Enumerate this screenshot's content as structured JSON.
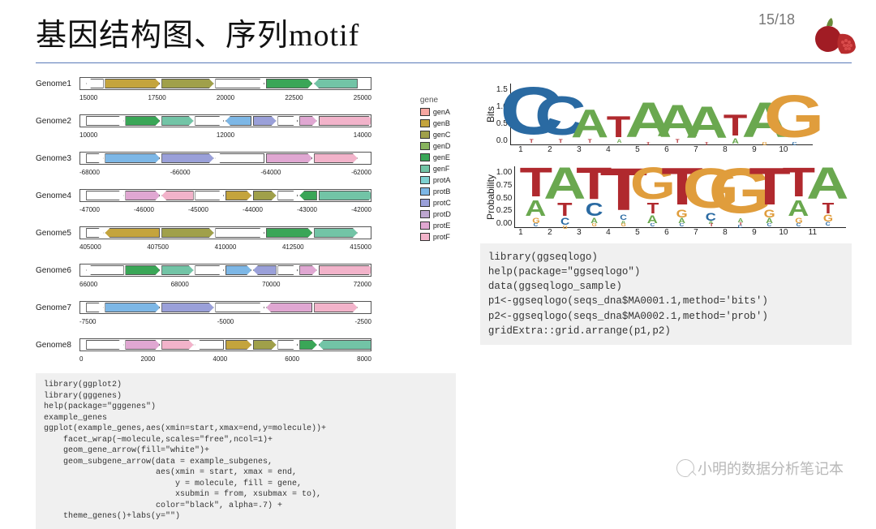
{
  "header": {
    "title": "基因结构图、序列motif",
    "page": "15/18"
  },
  "legend": {
    "title": "gene",
    "items": [
      {
        "label": "genA",
        "color": "#f5a6a0"
      },
      {
        "label": "genB",
        "color": "#c4a43d"
      },
      {
        "label": "genC",
        "color": "#a0a04a"
      },
      {
        "label": "genD",
        "color": "#87b35d"
      },
      {
        "label": "genE",
        "color": "#3aa657"
      },
      {
        "label": "genF",
        "color": "#72c4a6"
      },
      {
        "label": "protA",
        "color": "#7ed1d1"
      },
      {
        "label": "protB",
        "color": "#7db7e6"
      },
      {
        "label": "protC",
        "color": "#9aa0d9"
      },
      {
        "label": "protD",
        "color": "#bda6cf"
      },
      {
        "label": "protE",
        "color": "#e0a7d2"
      },
      {
        "label": "protF",
        "color": "#f2b3ca"
      }
    ]
  },
  "tracks": [
    {
      "name": "Genome1",
      "ticks": [
        "15000",
        "17500",
        "20000",
        "22500",
        "25000"
      ]
    },
    {
      "name": "Genome2",
      "ticks": [
        "10000",
        "12000",
        "14000"
      ]
    },
    {
      "name": "Genome3",
      "ticks": [
        "-68000",
        "-66000",
        "-64000",
        "-62000"
      ]
    },
    {
      "name": "Genome4",
      "ticks": [
        "-47000",
        "-46000",
        "-45000",
        "-44000",
        "-43000",
        "-42000"
      ]
    },
    {
      "name": "Genome5",
      "ticks": [
        "405000",
        "407500",
        "410000",
        "412500",
        "415000"
      ]
    },
    {
      "name": "Genome6",
      "ticks": [
        "66000",
        "68000",
        "70000",
        "72000"
      ]
    },
    {
      "name": "Genome7",
      "ticks": [
        "-7500",
        "-5000",
        "-2500"
      ]
    },
    {
      "name": "Genome8",
      "ticks": [
        "0",
        "2000",
        "4000",
        "6000",
        "8000"
      ]
    }
  ],
  "chart_data": [
    {
      "type": "sequence_logo",
      "method": "bits",
      "ylabel": "Bits",
      "yticks": [
        "0.0",
        "0.5",
        "1.0",
        "1.5"
      ],
      "positions": [
        1,
        2,
        3,
        4,
        5,
        6,
        7,
        8,
        9,
        10
      ],
      "columns": [
        [
          {
            "l": "C",
            "h": 1.35
          },
          {
            "l": "T",
            "h": 0.1
          }
        ],
        [
          {
            "l": "C",
            "h": 1.1
          },
          {
            "l": "T",
            "h": 0.1
          }
        ],
        [
          {
            "l": "A",
            "h": 0.8
          },
          {
            "l": "T",
            "h": 0.1
          }
        ],
        [
          {
            "l": "T",
            "h": 0.6
          },
          {
            "l": "A",
            "h": 0.1
          }
        ],
        [
          {
            "l": "A",
            "h": 1.0
          },
          {
            "l": "T",
            "h": 0.05
          }
        ],
        [
          {
            "l": "A",
            "h": 0.9
          },
          {
            "l": "T",
            "h": 0.1
          }
        ],
        [
          {
            "l": "A",
            "h": 0.9
          },
          {
            "l": "T",
            "h": 0.05
          }
        ],
        [
          {
            "l": "T",
            "h": 0.6
          },
          {
            "l": "A",
            "h": 0.15
          }
        ],
        [
          {
            "l": "A",
            "h": 1.0
          },
          {
            "l": "G",
            "h": 0.05
          }
        ],
        [
          {
            "l": "G",
            "h": 1.2
          },
          {
            "l": "C",
            "h": 0.05
          }
        ]
      ],
      "ymax": 1.5
    },
    {
      "type": "sequence_logo",
      "method": "probability",
      "ylabel": "Probability",
      "yticks": [
        "0.00",
        "0.25",
        "0.50",
        "0.75",
        "1.00"
      ],
      "positions": [
        1,
        2,
        3,
        4,
        5,
        6,
        7,
        8,
        9,
        10,
        11
      ],
      "columns": [
        [
          {
            "l": "T",
            "h": 0.55
          },
          {
            "l": "A",
            "h": 0.3
          },
          {
            "l": "G",
            "h": 0.1
          },
          {
            "l": "C",
            "h": 0.05
          }
        ],
        [
          {
            "l": "A",
            "h": 0.6
          },
          {
            "l": "T",
            "h": 0.25
          },
          {
            "l": "C",
            "h": 0.13
          },
          {
            "l": "G",
            "h": 0.02
          }
        ],
        [
          {
            "l": "T",
            "h": 0.6
          },
          {
            "l": "C",
            "h": 0.25
          },
          {
            "l": "A",
            "h": 0.1
          },
          {
            "l": "G",
            "h": 0.05
          }
        ],
        [
          {
            "l": "T",
            "h": 0.8
          },
          {
            "l": "C",
            "h": 0.1
          },
          {
            "l": "A",
            "h": 0.05
          },
          {
            "l": "G",
            "h": 0.05
          }
        ],
        [
          {
            "l": "G",
            "h": 0.6
          },
          {
            "l": "T",
            "h": 0.2
          },
          {
            "l": "A",
            "h": 0.15
          },
          {
            "l": "C",
            "h": 0.05
          }
        ],
        [
          {
            "l": "T",
            "h": 0.7
          },
          {
            "l": "G",
            "h": 0.15
          },
          {
            "l": "A",
            "h": 0.1
          },
          {
            "l": "C",
            "h": 0.05
          }
        ],
        [
          {
            "l": "G",
            "h": 0.75
          },
          {
            "l": "C",
            "h": 0.15
          },
          {
            "l": "A",
            "h": 0.05
          },
          {
            "l": "T",
            "h": 0.05
          }
        ],
        [
          {
            "l": "G",
            "h": 0.85
          },
          {
            "l": "A",
            "h": 0.08
          },
          {
            "l": "T",
            "h": 0.04
          },
          {
            "l": "C",
            "h": 0.03
          }
        ],
        [
          {
            "l": "T",
            "h": 0.7
          },
          {
            "l": "G",
            "h": 0.15
          },
          {
            "l": "A",
            "h": 0.1
          },
          {
            "l": "C",
            "h": 0.05
          }
        ],
        [
          {
            "l": "T",
            "h": 0.55
          },
          {
            "l": "A",
            "h": 0.3
          },
          {
            "l": "G",
            "h": 0.1
          },
          {
            "l": "C",
            "h": 0.05
          }
        ],
        [
          {
            "l": "A",
            "h": 0.6
          },
          {
            "l": "T",
            "h": 0.2
          },
          {
            "l": "G",
            "h": 0.13
          },
          {
            "l": "C",
            "h": 0.07
          }
        ]
      ],
      "ymax": 1.0
    }
  ],
  "code_left": "library(ggplot2)\nlibrary(gggenes)\nhelp(package=\"gggenes\")\nexample_genes\nggplot(example_genes,aes(xmin=start,xmax=end,y=molecule))+\n    facet_wrap(~molecule,scales=\"free\",ncol=1)+\n    geom_gene_arrow(fill=\"white\")+\n    geom_subgene_arrow(data = example_subgenes,\n                       aes(xmin = start, xmax = end,\n                           y = molecule, fill = gene,\n                           xsubmin = from, xsubmax = to),\n                       color=\"black\", alpha=.7) +\n    theme_genes()+labs(y=\"\")",
  "code_right": "library(ggseqlogo)\nhelp(package=\"ggseqlogo\")\ndata(ggseqlogo_sample)\np1<-ggseqlogo(seqs_dna$MA0001.1,method='bits')\np2<-ggseqlogo(seqs_dna$MA0002.1,method='prob')\ngridExtra::grid.arrange(p1,p2)",
  "watermark": "小明的数据分析笔记本"
}
